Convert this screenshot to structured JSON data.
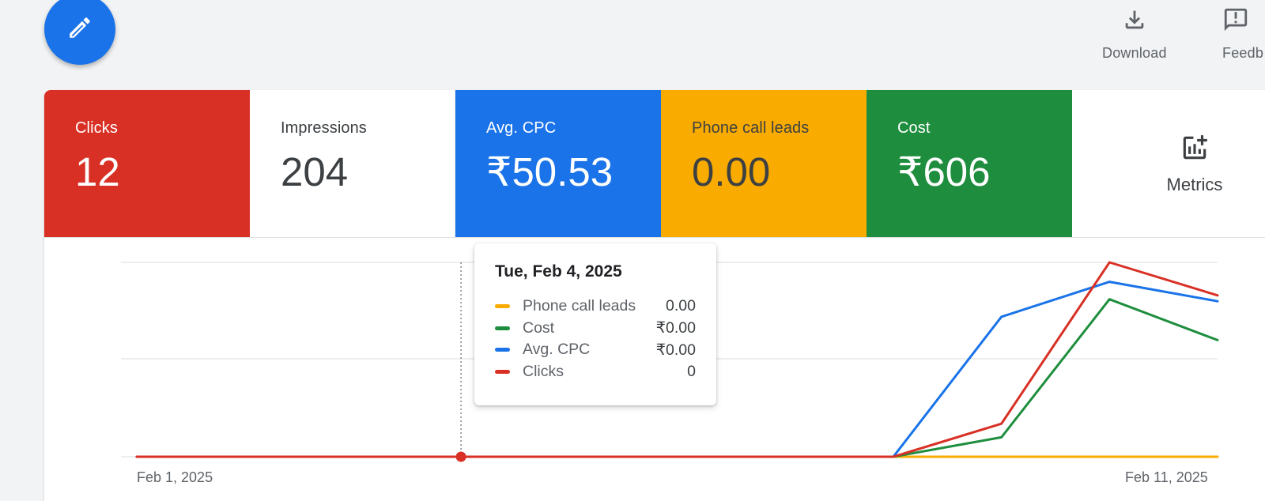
{
  "toolbar": {
    "fab_icon": "pencil-icon",
    "download_label": "Download",
    "download_icon": "download-icon",
    "feedback_label": "Feedb",
    "feedback_icon": "feedback-icon"
  },
  "scorecards": [
    {
      "label": "Clicks",
      "value": "12",
      "color": "#d93025"
    },
    {
      "label": "Impressions",
      "value": "204",
      "color": "#ffffff"
    },
    {
      "label": "Avg. CPC",
      "value": "₹50.53",
      "color": "#1a73e8"
    },
    {
      "label": "Phone call leads",
      "value": "0.00",
      "color": "#f9ab00"
    },
    {
      "label": "Cost",
      "value": "₹606",
      "color": "#1e8e3e"
    }
  ],
  "metrics_button": {
    "label": "Metrics",
    "icon": "add-chart-icon"
  },
  "tooltip": {
    "date": "Tue, Feb 4, 2025",
    "rows": [
      {
        "name": "Phone call leads",
        "value": "0.00",
        "color": "#f9ab00"
      },
      {
        "name": "Cost",
        "value": "₹0.00",
        "color": "#1e8e3e"
      },
      {
        "name": "Avg. CPC",
        "value": "₹0.00",
        "color": "#1a73e8"
      },
      {
        "name": "Clicks",
        "value": "0",
        "color": "#d93025"
      }
    ]
  },
  "chart_data": {
    "type": "line",
    "x": [
      "Feb 1, 2025",
      "Feb 2, 2025",
      "Feb 3, 2025",
      "Feb 4, 2025",
      "Feb 5, 2025",
      "Feb 6, 2025",
      "Feb 7, 2025",
      "Feb 8, 2025",
      "Feb 9, 2025",
      "Feb 10, 2025",
      "Feb 11, 2025"
    ],
    "x_tick_labels": [
      "Feb 1, 2025",
      "Feb 11, 2025"
    ],
    "highlighted_index": 3,
    "grid": true,
    "series": [
      {
        "name": "Phone call leads",
        "color": "#f9ab00",
        "relative_values": [
          0,
          0,
          0,
          0,
          0,
          0,
          0,
          0,
          0,
          0,
          0
        ]
      },
      {
        "name": "Cost",
        "color": "#1e8e3e",
        "relative_values": [
          0,
          0,
          0,
          0,
          0,
          0,
          0,
          0,
          0.1,
          0.81,
          0.6
        ]
      },
      {
        "name": "Avg. CPC",
        "color": "#1a73e8",
        "relative_values": [
          0,
          0,
          0,
          0,
          0,
          0,
          0,
          0,
          0.72,
          0.9,
          0.8
        ]
      },
      {
        "name": "Clicks",
        "color": "#d93025",
        "relative_values": [
          0,
          0,
          0,
          0,
          0,
          0,
          0,
          0,
          0.17,
          1.0,
          0.83
        ]
      }
    ]
  }
}
